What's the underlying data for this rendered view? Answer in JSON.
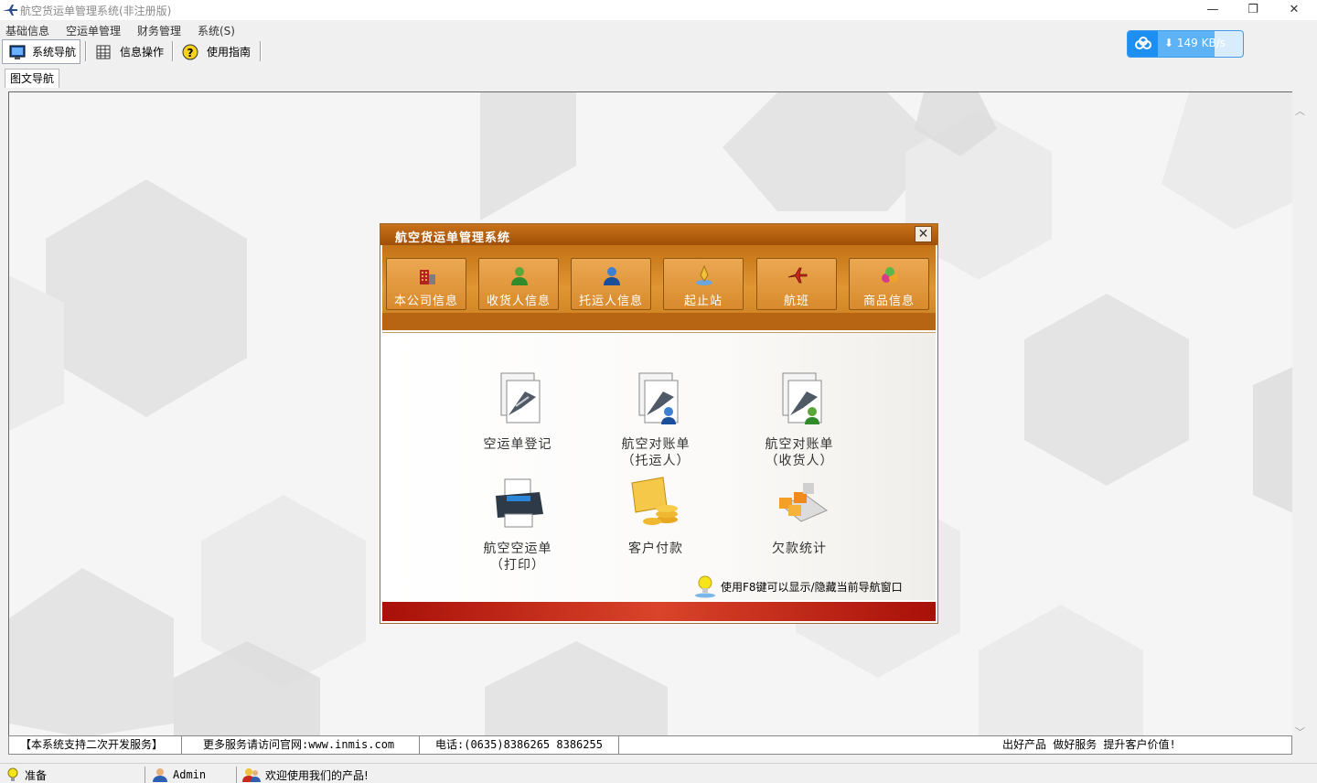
{
  "window": {
    "title": "航空货运单管理系统(非注册版)",
    "minimize": "—",
    "restore": "❐",
    "close": "✕"
  },
  "menu": [
    "基础信息",
    "空运单管理",
    "财务管理",
    "系统(S)"
  ],
  "toolbar": {
    "items": [
      {
        "label": "系统导航",
        "icon": "monitor-icon"
      },
      {
        "label": "信息操作",
        "icon": "grid-icon"
      },
      {
        "label": "使用指南",
        "icon": "help-icon"
      }
    ]
  },
  "speed_widget": {
    "value": "149 KB/s",
    "icon": "cloud-icon",
    "accent": "#1d8ff2"
  },
  "tabs": [
    "图文导航"
  ],
  "dialog": {
    "title": "航空货运单管理系统",
    "close": "✕",
    "top_buttons": [
      {
        "label": "本公司信息",
        "icon": "building-icon"
      },
      {
        "label": "收货人信息",
        "icon": "user-green-icon"
      },
      {
        "label": "托运人信息",
        "icon": "user-blue-icon"
      },
      {
        "label": "起止站",
        "icon": "station-icon"
      },
      {
        "label": "航班",
        "icon": "airplane-icon"
      },
      {
        "label": "商品信息",
        "icon": "goods-icon"
      }
    ],
    "nav_items": [
      {
        "line1": "空运单登记",
        "line2": "",
        "icon": "document-plane-icon"
      },
      {
        "line1": "航空对账单",
        "line2": "（托运人）",
        "icon": "document-plane-user-icon"
      },
      {
        "line1": "航空对账单",
        "line2": "（收货人）",
        "icon": "document-plane-user-icon"
      },
      {
        "line1": "航空空运单",
        "line2": "（打印）",
        "icon": "printer-icon"
      },
      {
        "line1": "客户付款",
        "line2": "",
        "icon": "coins-icon"
      },
      {
        "line1": "欠款统计",
        "line2": "",
        "icon": "boxes-icon"
      }
    ],
    "hint": "使用F8键可以显示/隐藏当前导航窗口"
  },
  "info_row": {
    "support": "【本系统支持二次开发服务】",
    "website": "更多服务请访问官网:www.inmis.com",
    "phone": "电话:(0635)8386265 8386255",
    "slogan": "出好产品 做好服务 提升客户价值!"
  },
  "status_bar": {
    "state": "准备",
    "user": "Admin",
    "message": "欢迎使用我们的产品!"
  },
  "colors": {
    "dialog_band": "#d88a2c",
    "dialog_footer": "#c0301c",
    "dialog_title": "#b15c0e"
  }
}
